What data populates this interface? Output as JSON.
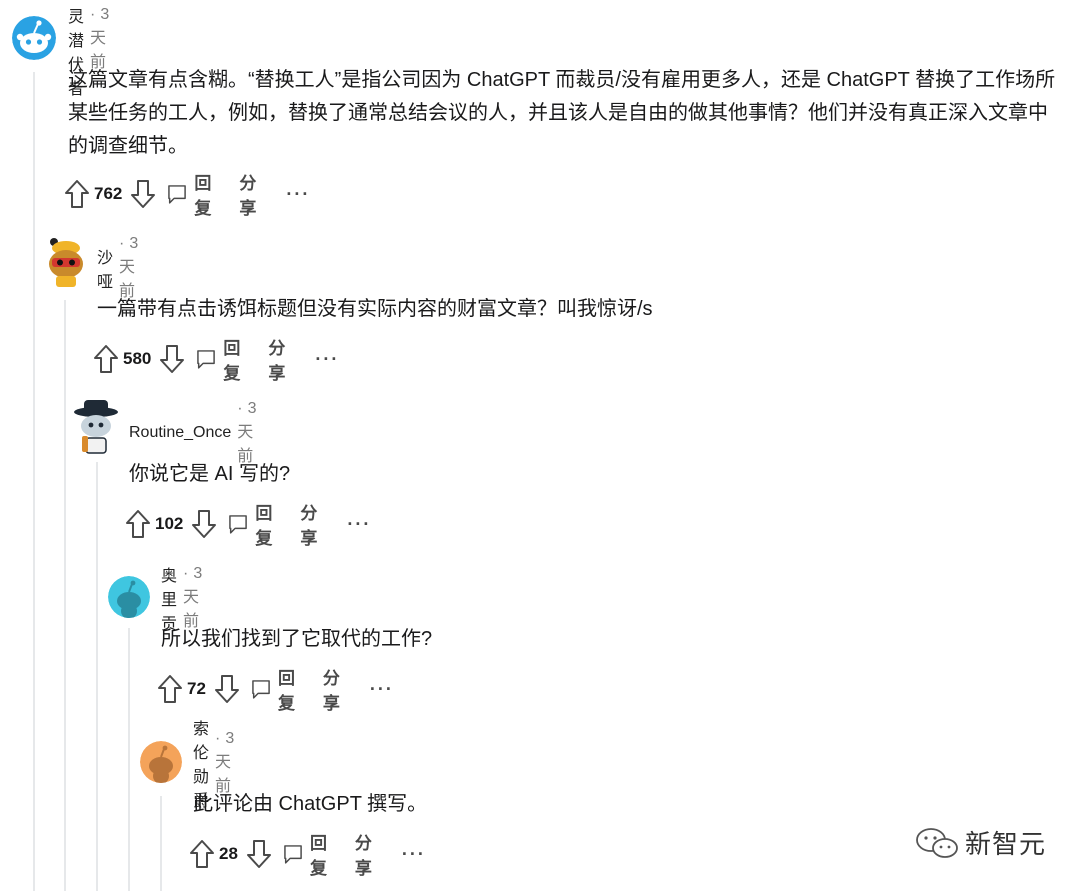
{
  "comments": [
    {
      "author": "图灵潜伏者",
      "time": "3天前",
      "body": "这篇文章有点含糊。“替换工人”是指公司因为 ChatGPT 而裁员/没有雇用更多人，还是 ChatGPT 替换了工作场所某些任务的工人，例如，替换了通常总结会议的人，并且该人是自由的做其他事情？他们并没有真正深入文章中的调查细节。",
      "score": "762",
      "reply_label": "回复",
      "share_label": "分享",
      "more_label": "···"
    },
    {
      "author": "沙哑",
      "time": "3天前",
      "body": "一篇带有点击诱饵标题但没有实际内容的财富文章？叫我惊讶/s",
      "score": "580",
      "reply_label": "回复",
      "share_label": "分享",
      "more_label": "···"
    },
    {
      "author": "Routine_Once",
      "time": "3天前",
      "body": "你说它是 AI 写的?",
      "score": "102",
      "reply_label": "回复",
      "share_label": "分享",
      "more_label": "···"
    },
    {
      "author": "奥里贡",
      "time": "3天前",
      "body": "所以我们找到了它取代的工作?",
      "score": "72",
      "reply_label": "回复",
      "share_label": "分享",
      "more_label": "···"
    },
    {
      "author": "索伦勋爵",
      "time": "3天前",
      "body": "此评论由 ChatGPT 撰写。",
      "score": "28",
      "reply_label": "回复",
      "share_label": "分享",
      "more_label": "···"
    }
  ],
  "watermark": {
    "text": "新智元",
    "icon": "wechat-icon"
  },
  "colors": {
    "thread_line": "#e6e8ea",
    "meta": "#7c7c7c",
    "action": "#4a4a4a",
    "avatar_blue": "#2aa2e3",
    "avatar_teal": "#3fc6e0",
    "avatar_orange": "#f4a35a"
  }
}
